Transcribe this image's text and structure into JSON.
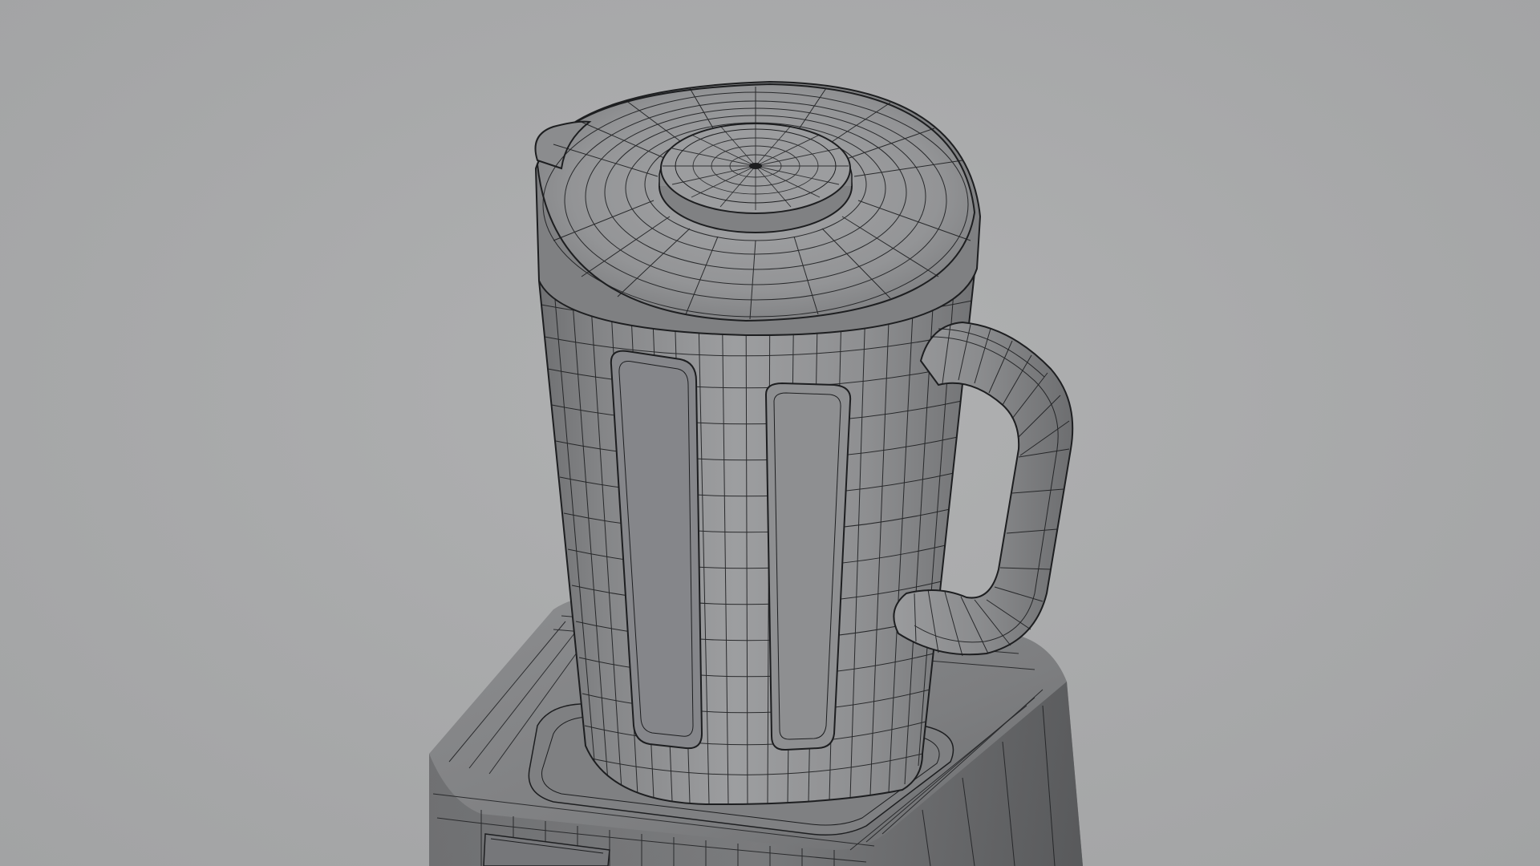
{
  "viewport": {
    "background_color": "#a9aaab",
    "shaded_color": "#8f9092",
    "wire_color": "#1d1e20"
  },
  "model": {
    "object": "blender",
    "parts": [
      "jug-body",
      "jug-lid",
      "lid-cap",
      "spout",
      "handle",
      "motor-base",
      "control-panel"
    ],
    "display_mode": "shaded-with-wireframe"
  }
}
